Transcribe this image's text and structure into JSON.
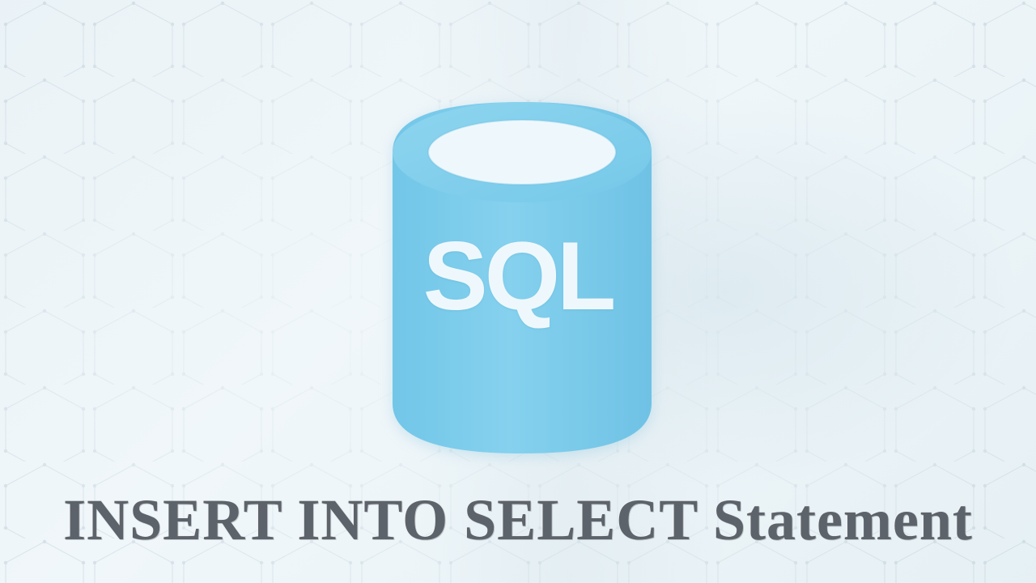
{
  "logo": {
    "text": "SQL",
    "icon_name": "database-cylinder-icon",
    "color": "#79cbea"
  },
  "title": "INSERT INTO SELECT Statement"
}
